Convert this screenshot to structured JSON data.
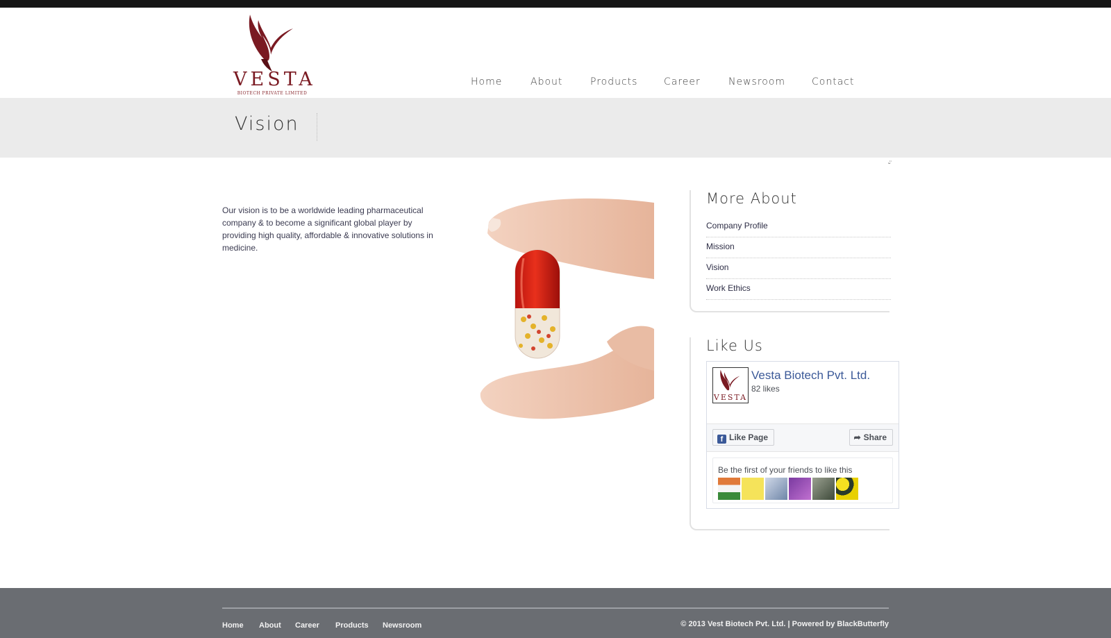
{
  "brand": {
    "name": "VESTA",
    "tagline": "BIOTECH PRIVATE LIMITED",
    "primary_color": "#7a1a22"
  },
  "nav": {
    "items": [
      {
        "label": "Home"
      },
      {
        "label": "About"
      },
      {
        "label": "Products"
      },
      {
        "label": "Career"
      },
      {
        "label": "Newsroom"
      },
      {
        "label": "Contact"
      }
    ]
  },
  "page": {
    "title": "Vision",
    "intro": "Our vision is to be a worldwide leading pharmaceutical company & to become a significant global player by providing high quality, affordable & innovative solutions in medicine.",
    "scroll_marker": "ᵕ̈"
  },
  "sidebar": {
    "more_about": {
      "title": "More About",
      "items": [
        {
          "label": "Company Profile"
        },
        {
          "label": "Mission"
        },
        {
          "label": "Vision"
        },
        {
          "label": "Work Ethics"
        }
      ]
    },
    "like_us": {
      "title": "Like Us",
      "facebook": {
        "page_name": "Vesta Biotech Pvt. Ltd.",
        "likes": "82 likes",
        "thumb_word": "VESTA",
        "like_button": "Like Page",
        "share_button": "Share",
        "friends_text": "Be the first of your friends to like this",
        "brand_color": "#3b5998"
      }
    }
  },
  "footer": {
    "nav": [
      {
        "label": "Home"
      },
      {
        "label": "About"
      },
      {
        "label": "Career"
      },
      {
        "label": "Products"
      },
      {
        "label": "Newsroom"
      }
    ],
    "copyright": "© 2013 Vest Biotech Pvt. Ltd. | Powered by BlackButterfly"
  }
}
